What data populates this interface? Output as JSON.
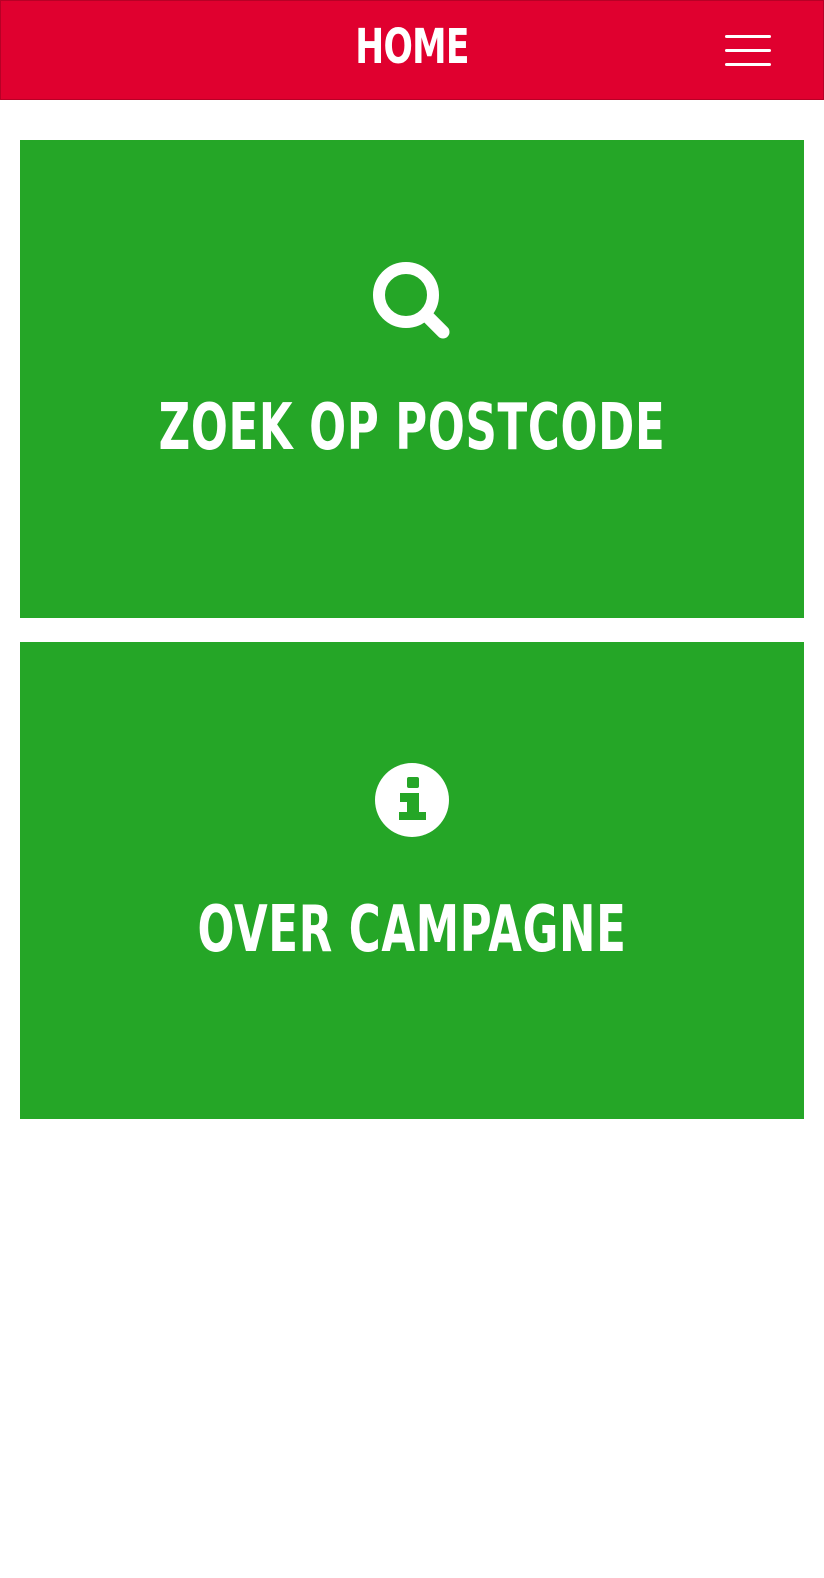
{
  "header": {
    "title": "HOME",
    "menu_icon": "hamburger-menu-icon"
  },
  "tiles": [
    {
      "label": "ZOEK OP POSTCODE",
      "icon": "search-icon"
    },
    {
      "label": "OVER CAMPAGNE",
      "icon": "info-icon"
    }
  ],
  "colors": {
    "header_bg": "#e0002f",
    "tile_bg": "#25a627",
    "text": "#ffffff"
  }
}
